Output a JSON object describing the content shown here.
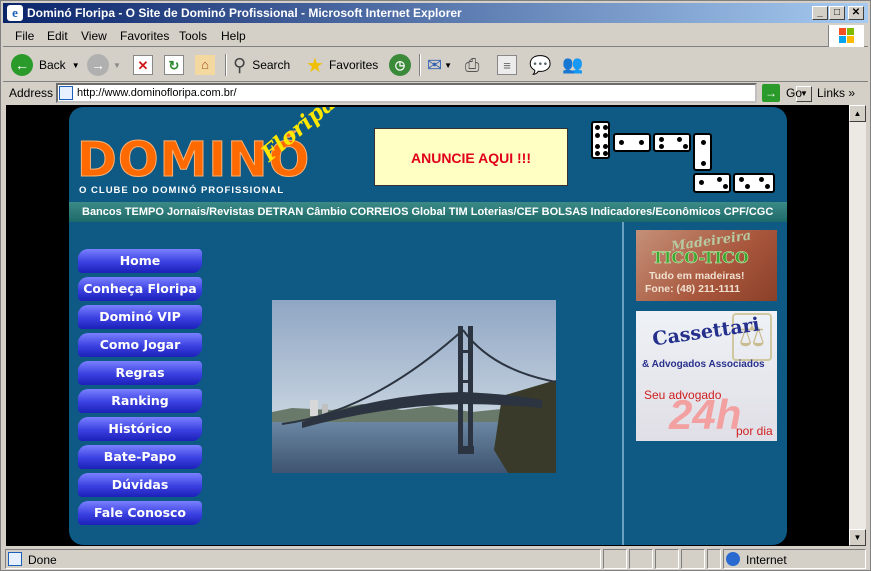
{
  "window": {
    "title": "Dominó Floripa - O Site de Dominó Profissional - Microsoft Internet Explorer",
    "min_glyph": "_",
    "max_glyph": "□",
    "close_glyph": "✕"
  },
  "menu": [
    "File",
    "Edit",
    "View",
    "Favorites",
    "Tools",
    "Help"
  ],
  "toolbar": {
    "back": "Back",
    "search": "Search",
    "favorites": "Favorites"
  },
  "address": {
    "label": "Address",
    "url": "http://www.dominofloripa.com.br/",
    "go": "Go",
    "links": "Links"
  },
  "site": {
    "logo_main": "DOMINÓ",
    "logo_script": "Floripa",
    "logo_tagline": "O CLUBE DO DOMINÓ PROFISSIONAL",
    "banner": "ANUNCIE AQUI !!!",
    "link_bar": "Bancos TEMPO Jornais/Revistas DETRAN Câmbio CORREIOS Global TIM Loterias/CEF BOLSAS Indicadores/Econômicos CPF/CGC",
    "nav": [
      "Home",
      "Conheça Floripa",
      "Dominó VIP",
      "Como Jogar",
      "Regras",
      "Ranking",
      "Histórico",
      "Bate-Papo",
      "Dúvidas",
      "Fale Conosco"
    ],
    "ad1": {
      "line1": "Madeireira",
      "line2": "TICO-TICO",
      "line3": "Tudo em madeiras!",
      "line4": "Fone: (48) 211-1111"
    },
    "ad2": {
      "name": "Cassettari",
      "sub": "& Advogados Associados",
      "tagline": "Seu advogado",
      "big": "24h",
      "per": "por dia"
    }
  },
  "status": {
    "text": "Done",
    "zone": "Internet"
  },
  "colors": {
    "page_bg": "#0e5a85",
    "logo_orange": "#ff6a00",
    "banner_red": "#e0001a",
    "nav_blue": "#3a40e0"
  }
}
